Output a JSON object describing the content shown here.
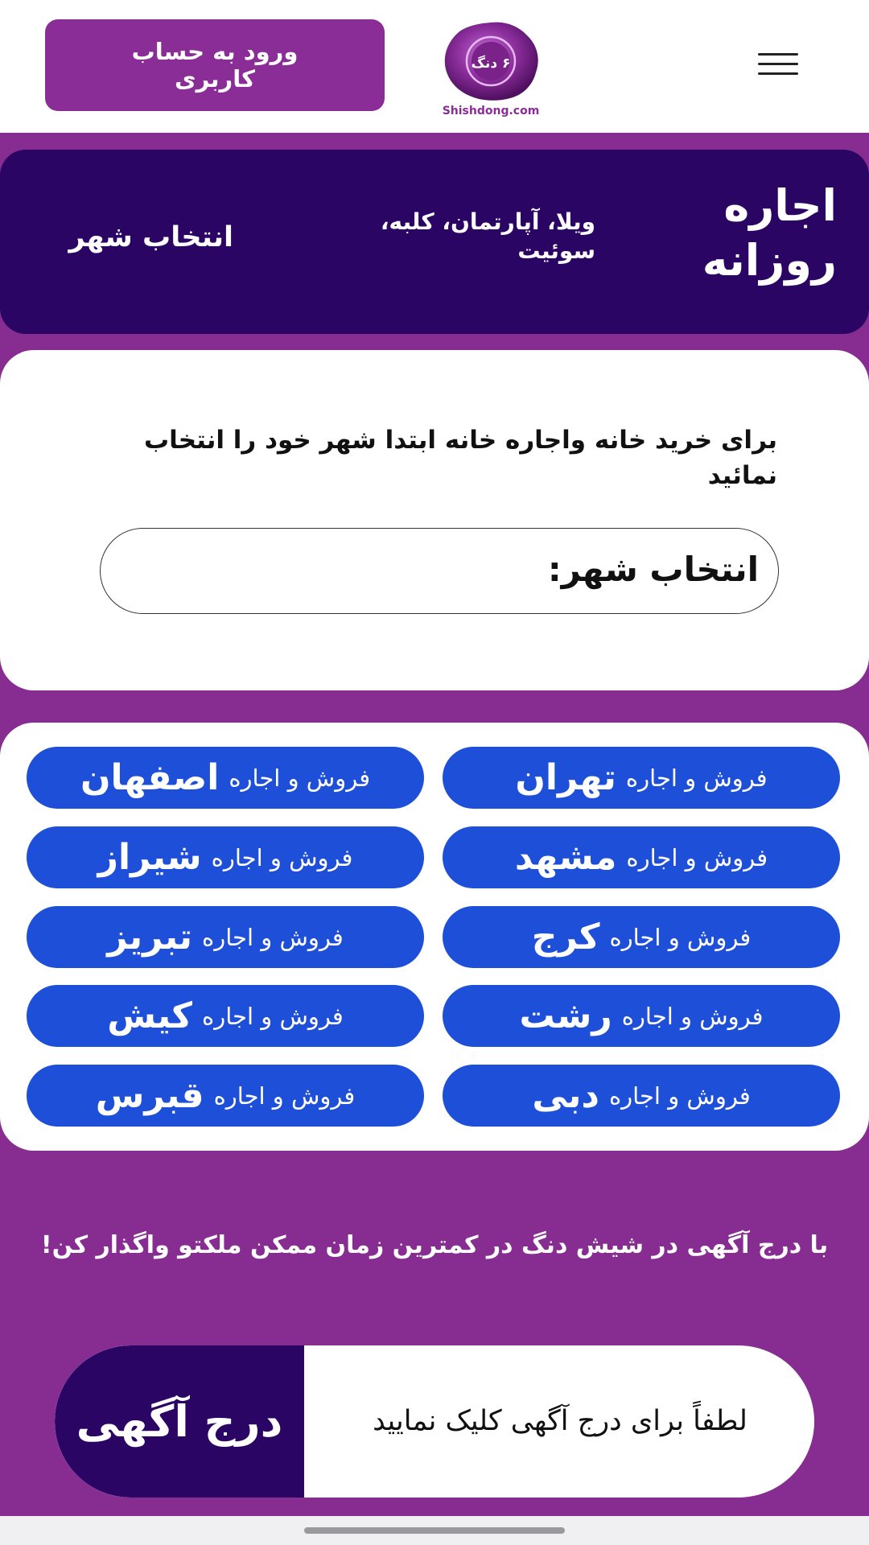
{
  "header": {
    "login_label": "ورود به حساب کاربری",
    "logo": {
      "seal_text": "۶ دنگ",
      "site": "Shishdong.com"
    },
    "menu_icon": "hamburger-icon"
  },
  "banner": {
    "title": "اجاره روزانه",
    "subtitle": "ویلا، آپارتمان، کلبه، سوئیت",
    "city_link": "انتخاب شهر"
  },
  "city_select": {
    "instruction": "برای خرید خانه واجاره خانه ابتدا شهر خود را انتخاب نمائید",
    "label": "انتخاب شهر:"
  },
  "cities": [
    {
      "prefix": "فروش و اجاره",
      "name": "تهران"
    },
    {
      "prefix": "فروش و اجاره",
      "name": "اصفهان"
    },
    {
      "prefix": "فروش و اجاره",
      "name": "مشهد"
    },
    {
      "prefix": "فروش و اجاره",
      "name": "شیراز"
    },
    {
      "prefix": "فروش و اجاره",
      "name": "کرج"
    },
    {
      "prefix": "فروش و اجاره",
      "name": "تبریز"
    },
    {
      "prefix": "فروش و اجاره",
      "name": "رشت"
    },
    {
      "prefix": "فروش و اجاره",
      "name": "کیش"
    },
    {
      "prefix": "فروش و اجاره",
      "name": "دبی"
    },
    {
      "prefix": "فروش و اجاره",
      "name": "قبرس"
    }
  ],
  "promo": "با درج آگهی در شیش دنگ در کمترین زمان ممکن ملکتو واگذار کن!",
  "post_ad": {
    "label": "درج آگهی",
    "hint": "لطفاً برای درج آگهی کلیک نمایید"
  },
  "colors": {
    "background": "#872c91",
    "dark_purple": "#2b0564",
    "city_button": "#1e4fd8",
    "login_button": "#8a2d96"
  }
}
